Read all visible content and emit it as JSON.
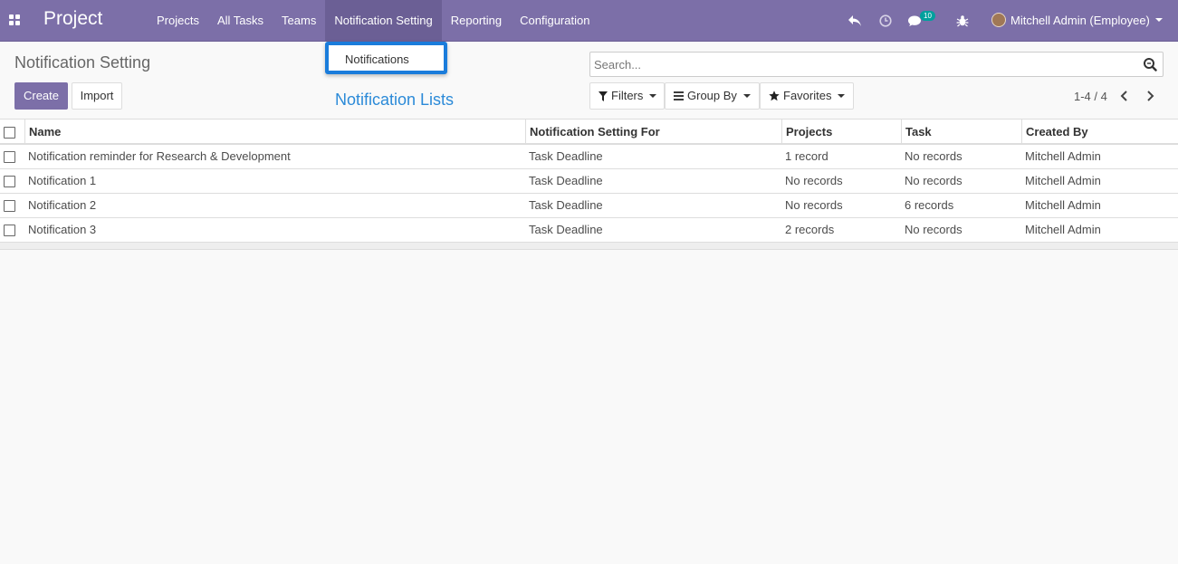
{
  "navbar": {
    "brand": "Project",
    "menu": [
      "Projects",
      "All Tasks",
      "Teams",
      "Notification Setting",
      "Reporting",
      "Configuration"
    ],
    "messages_count": "10",
    "user": "Mitchell Admin (Employee)"
  },
  "dropdown": {
    "item": "Notifications"
  },
  "annotation": "Notification Lists",
  "control_panel": {
    "title": "Notification Setting",
    "create_label": "Create",
    "import_label": "Import",
    "search_placeholder": "Search...",
    "filters_label": "Filters",
    "groupby_label": "Group By",
    "favorites_label": "Favorites",
    "pager": "1-4 / 4"
  },
  "table": {
    "columns": [
      "Name",
      "Notification Setting For",
      "Projects",
      "Task",
      "Created By"
    ],
    "rows": [
      [
        "Notification reminder for Research & Development",
        "Task Deadline",
        "1 record",
        "No records",
        "Mitchell Admin"
      ],
      [
        "Notification 1",
        "Task Deadline",
        "No records",
        "No records",
        "Mitchell Admin"
      ],
      [
        "Notification 2",
        "Task Deadline",
        "No records",
        "6 records",
        "Mitchell Admin"
      ],
      [
        "Notification 3",
        "Task Deadline",
        "2 records",
        "No records",
        "Mitchell Admin"
      ]
    ]
  },
  "colors": {
    "navbar": "#7c6fa8",
    "accent": "#1a7cdb",
    "badge": "#00a09d"
  }
}
